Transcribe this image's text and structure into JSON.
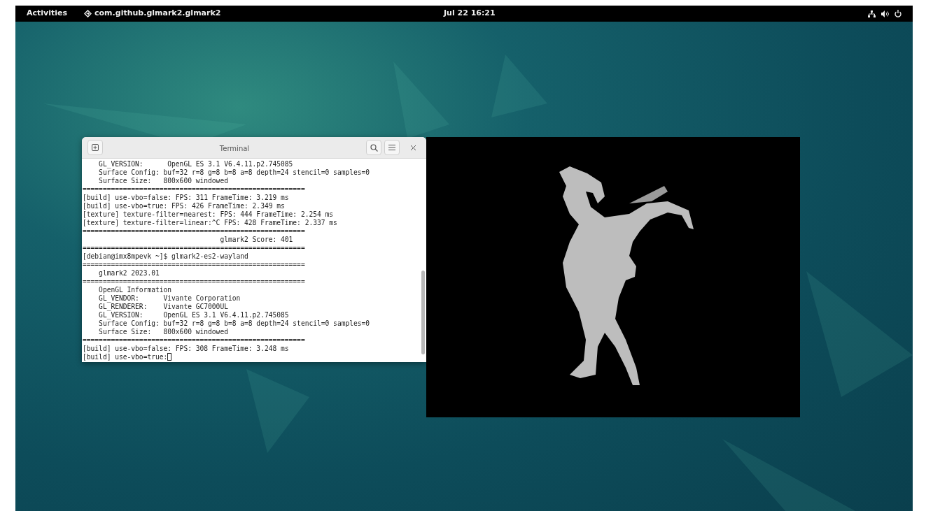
{
  "top_bar": {
    "activities": "Activities",
    "app_name": "com.github.glmark2.glmark2",
    "clock": "Jul 22  16:21"
  },
  "terminal": {
    "title": "Terminal",
    "cursor_visible": true,
    "lines": [
      "    GL_VERSION:      OpenGL ES 3.1 V6.4.11.p2.745085",
      "    Surface Config: buf=32 r=8 g=8 b=8 a=8 depth=24 stencil=0 samples=0",
      "    Surface Size:   800x600 windowed",
      "=======================================================",
      "[build] use-vbo=false: FPS: 311 FrameTime: 3.219 ms",
      "[build] use-vbo=true: FPS: 426 FrameTime: 2.349 ms",
      "[texture] texture-filter=nearest: FPS: 444 FrameTime: 2.254 ms",
      "[texture] texture-filter=linear:^C FPS: 428 FrameTime: 2.337 ms",
      "=======================================================",
      "                                  glmark2 Score: 401",
      "=======================================================",
      "[debian@imx8mpevk ~]$ glmark2-es2-wayland",
      "=======================================================",
      "    glmark2 2023.01",
      "=======================================================",
      "    OpenGL Information",
      "    GL_VENDOR:      Vivante Corporation",
      "    GL_RENDERER:    Vivante GC7000UL",
      "    GL_VERSION:     OpenGL ES 3.1 V6.4.11.p2.745085",
      "    Surface Config: buf=32 r=8 g=8 b=8 a=8 depth=24 stencil=0 samples=0",
      "    Surface Size:   800x600 windowed",
      "=======================================================",
      "[build] use-vbo=false: FPS: 308 FrameTime: 3.248 ms",
      "[build] use-vbo=true:"
    ]
  }
}
